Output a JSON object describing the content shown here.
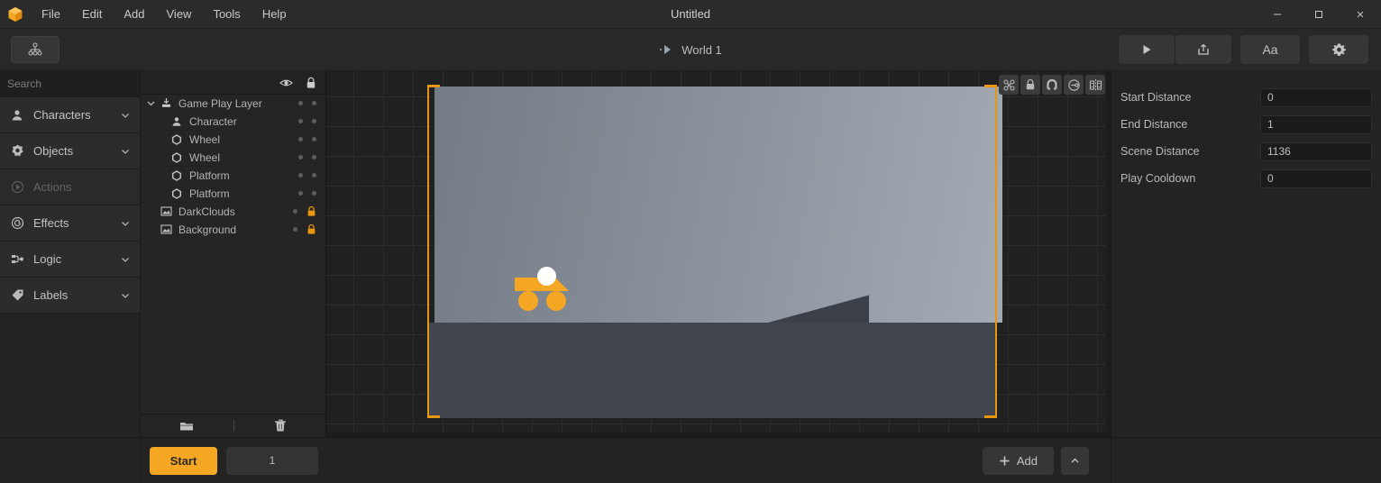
{
  "window": {
    "title": "Untitled",
    "minimize_label": "minimize",
    "maximize_label": "maximize",
    "close_label": "close"
  },
  "menu": {
    "items": [
      {
        "label": "File"
      },
      {
        "label": "Edit"
      },
      {
        "label": "Add"
      },
      {
        "label": "View"
      },
      {
        "label": "Tools"
      },
      {
        "label": "Help"
      }
    ]
  },
  "toolbar": {
    "hierarchy_icon": "hierarchy-icon",
    "world_label": "World 1",
    "world_play_icon": "play-triangle-icon",
    "play_icon": "play-icon",
    "export_icon": "export-icon",
    "text_label": "Aa",
    "settings_icon": "gear-icon"
  },
  "sidebar": {
    "search": {
      "value": "",
      "placeholder": "Search",
      "icon": "search-icon"
    },
    "items": [
      {
        "label": "Characters",
        "icon": "person-icon",
        "expandable": true,
        "disabled": false
      },
      {
        "label": "Objects",
        "icon": "gear-shape-icon",
        "expandable": true,
        "disabled": false
      },
      {
        "label": "Actions",
        "icon": "play-circle-icon",
        "expandable": false,
        "disabled": true
      },
      {
        "label": "Effects",
        "icon": "spiral-icon",
        "expandable": true,
        "disabled": false
      },
      {
        "label": "Logic",
        "icon": "logic-node-icon",
        "expandable": true,
        "disabled": false
      },
      {
        "label": "Labels",
        "icon": "tag-icon",
        "expandable": true,
        "disabled": false
      }
    ]
  },
  "layers": {
    "header": {
      "visibility_icon": "eye-icon",
      "lock_icon": "lock-icon"
    },
    "rows": [
      {
        "label": "Game Play Layer",
        "icon": "layer-icon",
        "indent": 0,
        "expanded": true,
        "locked": false
      },
      {
        "label": "Character",
        "icon": "person-icon",
        "indent": 1,
        "expanded": null,
        "locked": false
      },
      {
        "label": "Wheel",
        "icon": "shape-icon",
        "indent": 1,
        "expanded": null,
        "locked": false
      },
      {
        "label": "Wheel",
        "icon": "shape-icon",
        "indent": 1,
        "expanded": null,
        "locked": false
      },
      {
        "label": "Platform",
        "icon": "shape-icon",
        "indent": 1,
        "expanded": null,
        "locked": false
      },
      {
        "label": "Platform",
        "icon": "shape-icon",
        "indent": 1,
        "expanded": null,
        "locked": false
      },
      {
        "label": "DarkClouds",
        "icon": "image-icon",
        "indent": 0,
        "expanded": null,
        "locked": true
      },
      {
        "label": "Background",
        "icon": "image-icon",
        "indent": 0,
        "expanded": null,
        "locked": true
      }
    ],
    "footer": {
      "folder_icon": "folder-icon",
      "delete_icon": "trash-icon"
    }
  },
  "canvas": {
    "tools": [
      {
        "name": "transform-nodes-icon"
      },
      {
        "name": "lock-icon"
      },
      {
        "name": "magnet-snap-icon"
      },
      {
        "name": "link-icon"
      },
      {
        "name": "mirror-symmetry-icon"
      }
    ],
    "selection_handle_icon": "resize-arrow-icon",
    "scene_objects": [
      "character",
      "wheel",
      "wheel",
      "platform",
      "platform"
    ]
  },
  "properties": {
    "rows": [
      {
        "label": "Start Distance",
        "value": "0"
      },
      {
        "label": "End Distance",
        "value": "1"
      },
      {
        "label": "Scene Distance",
        "value": "1136"
      },
      {
        "label": "Play Cooldown",
        "value": "0"
      }
    ]
  },
  "bottom": {
    "start_label": "Start",
    "frame_value": "1",
    "add_label": "Add",
    "add_icon": "plus-icon",
    "collapse_icon": "chevron-up-icon"
  },
  "colors": {
    "accent": "#f5a623",
    "selection": "#e8960f",
    "panel": "#232323",
    "titlebar": "#2b2b2b",
    "scene_sky_left": "#737b85",
    "scene_sky_right": "#a4abb4",
    "ground": "#41464e"
  }
}
